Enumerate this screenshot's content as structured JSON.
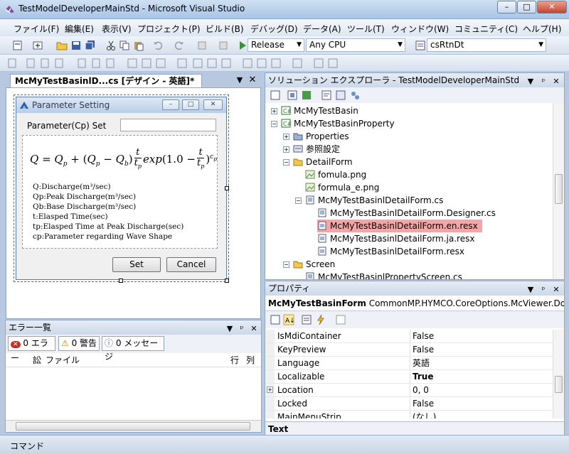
{
  "window": {
    "title": "TestModelDeveloperMainStd - Microsoft Visual Studio",
    "min_label": "–",
    "max_label": "□",
    "close_label": "✕"
  },
  "menu": [
    "ファイル(F)",
    "編集(E)",
    "表示(V)",
    "プロジェクト(P)",
    "ビルド(B)",
    "デバッグ(D)",
    "データ(A)",
    "ツール(T)",
    "ウィンドウ(W)",
    "コミュニティ(C)",
    "ヘルプ(H)"
  ],
  "toolbar": {
    "configuration": "Release",
    "platform": "Any CPU",
    "find_value": "csRtnDt"
  },
  "document": {
    "tab_label": "McMyTestBasinlD...cs [デザイン - 英語]*",
    "form": {
      "title": "Parameter Setting",
      "param_label": "Parameter(Cp) Set",
      "param_value": "",
      "formula": "Q = Q_p + (Q_p − Q_b) (t / t_p) exp(1.0 − t / t_p)^(c_p)",
      "legend": [
        "Q:Discharge(m³/sec)",
        "Qp:Peak Discharge(m³/sec)",
        "Qb:Base Discharge(m³/sec)",
        "t:Elasped Time(sec)",
        "tp:Elasped Time at Peak Discharge(sec)",
        "cp:Parameter regarding Wave Shape"
      ],
      "set_button": "Set",
      "cancel_button": "Cancel"
    }
  },
  "error_list": {
    "title": "エラー一覧",
    "errors": "0 エラー",
    "warnings": "0 警告",
    "messages": "0 メッセージ",
    "col_file": "ファイル",
    "col_line": "行",
    "col_col": "列"
  },
  "solution": {
    "title": "ソリューション エクスプローラ - TestModelDeveloperMainStd",
    "items": [
      {
        "label": "McMyTestBasin",
        "indent": 0,
        "toggle": "+"
      },
      {
        "label": "McMyTestBasinProperty",
        "indent": 0,
        "toggle": "−"
      },
      {
        "label": "Properties",
        "indent": 1,
        "toggle": "+"
      },
      {
        "label": "参照設定",
        "indent": 1,
        "toggle": "+"
      },
      {
        "label": "DetailForm",
        "indent": 1,
        "toggle": "−"
      },
      {
        "label": "fomula.png",
        "indent": 2,
        "toggle": ""
      },
      {
        "label": "formula_e.png",
        "indent": 2,
        "toggle": ""
      },
      {
        "label": "McMyTestBasinlDetailForm.cs",
        "indent": 2,
        "toggle": "−"
      },
      {
        "label": "McMyTestBasinlDetailForm.Designer.cs",
        "indent": 3,
        "toggle": ""
      },
      {
        "label": "McMyTestBasinlDetailForm.en.resx",
        "indent": 3,
        "toggle": "",
        "selected": true
      },
      {
        "label": "McMyTestBasinlDetailForm.ja.resx",
        "indent": 3,
        "toggle": ""
      },
      {
        "label": "McMyTestBasinlDetailForm.resx",
        "indent": 3,
        "toggle": ""
      },
      {
        "label": "Screen",
        "indent": 1,
        "toggle": "−"
      },
      {
        "label": "McMyTestBasinlPropertyScreen.cs",
        "indent": 2,
        "toggle": ""
      }
    ]
  },
  "properties": {
    "title": "プロパティ",
    "object_name": "McMyTestBasinForm",
    "object_type": "CommonMP.HYMCO.CoreOptions.McViewer.DotNetViewer",
    "rows": [
      {
        "name": "IsMdiContainer",
        "value": "False"
      },
      {
        "name": "KeyPreview",
        "value": "False"
      },
      {
        "name": "Language",
        "value": "英語"
      },
      {
        "name": "Localizable",
        "value": "True",
        "bold": true
      },
      {
        "name": "Location",
        "value": "0, 0",
        "expandable": true
      },
      {
        "name": "Locked",
        "value": "False"
      },
      {
        "name": "MainMenuStrip",
        "value": "(なし)"
      }
    ],
    "description_title": "Text"
  },
  "status": {
    "text": "コマンド"
  },
  "colors": {
    "selection": "#f4a6a6",
    "accent": "#3a6ea5"
  }
}
